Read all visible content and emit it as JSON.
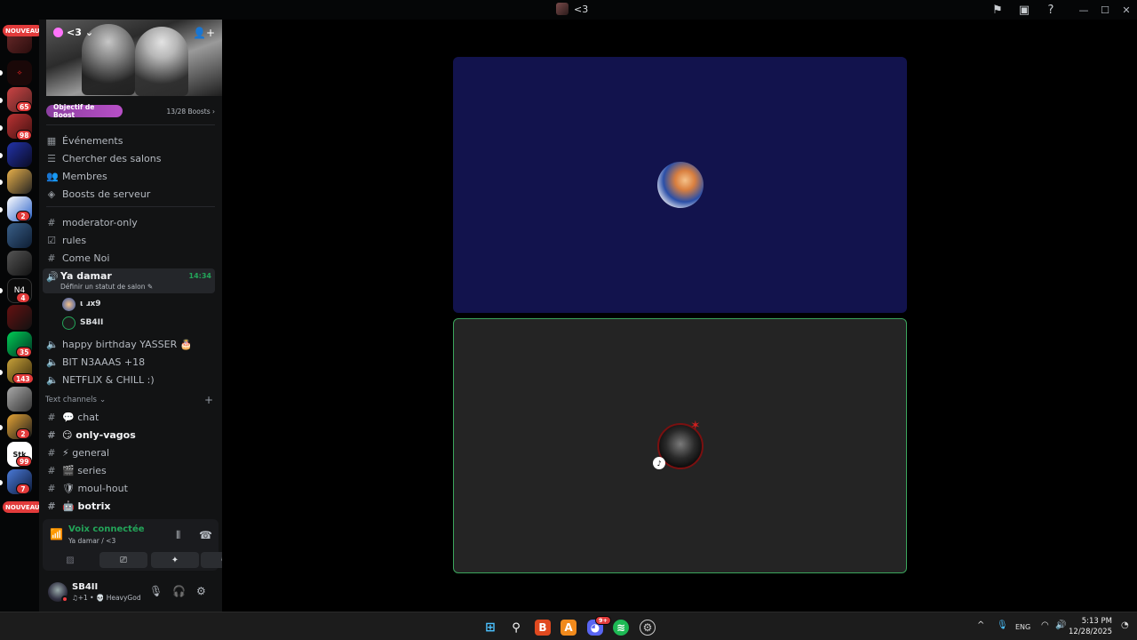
{
  "window": {
    "title": "<3"
  },
  "rail": {
    "badges": [
      "65",
      "98",
      "2",
      "4",
      "35",
      "143",
      "2",
      "99",
      "7"
    ],
    "new_label": "NOUVEAU"
  },
  "server": {
    "name": "<3",
    "boost_goal_label": "Objectif de Boost",
    "boost_count": "13/28 Boosts",
    "menu": [
      "Événements",
      "Chercher des salons",
      "Membres",
      "Boosts de serveur"
    ]
  },
  "channels": {
    "top": [
      "moderator-only",
      "rules",
      "Come Noi"
    ],
    "active_voice": {
      "name": "Ya damar",
      "status_hint": "Définir un statut de salon",
      "time": "14:34",
      "users": [
        "ι ɹx9",
        "SB4II"
      ]
    },
    "voice": [
      "happy birthday YASSER 🎂",
      "BIT N3AAAS +18",
      "NETFLIX & CHILL :)"
    ],
    "category": "Text channels",
    "text": [
      {
        "name": "💬 chat",
        "unread": false
      },
      {
        "name": "😏 only-vagos",
        "unread": true
      },
      {
        "name": "⚡ general",
        "unread": false
      },
      {
        "name": "🎬 series",
        "unread": false
      },
      {
        "name": "🛡 moul-hout",
        "unread": false
      },
      {
        "name": "🤖 botrix",
        "unread": true
      }
    ]
  },
  "voice_panel": {
    "state": "Voix connectée",
    "location": "Ya damar / <3"
  },
  "user": {
    "name": "SB4II",
    "status": "♫+1 • 💀 HeavyGod"
  },
  "taskbar": {
    "lang": "ENG",
    "time": "5:13 PM",
    "date": "12/28/2025",
    "discord_badge": "9+"
  },
  "colors": {
    "accent_green": "#23a559",
    "tile1_bg": "#12134d",
    "tile2_border": "#3ba55c",
    "badge_red": "#e23b3b"
  }
}
